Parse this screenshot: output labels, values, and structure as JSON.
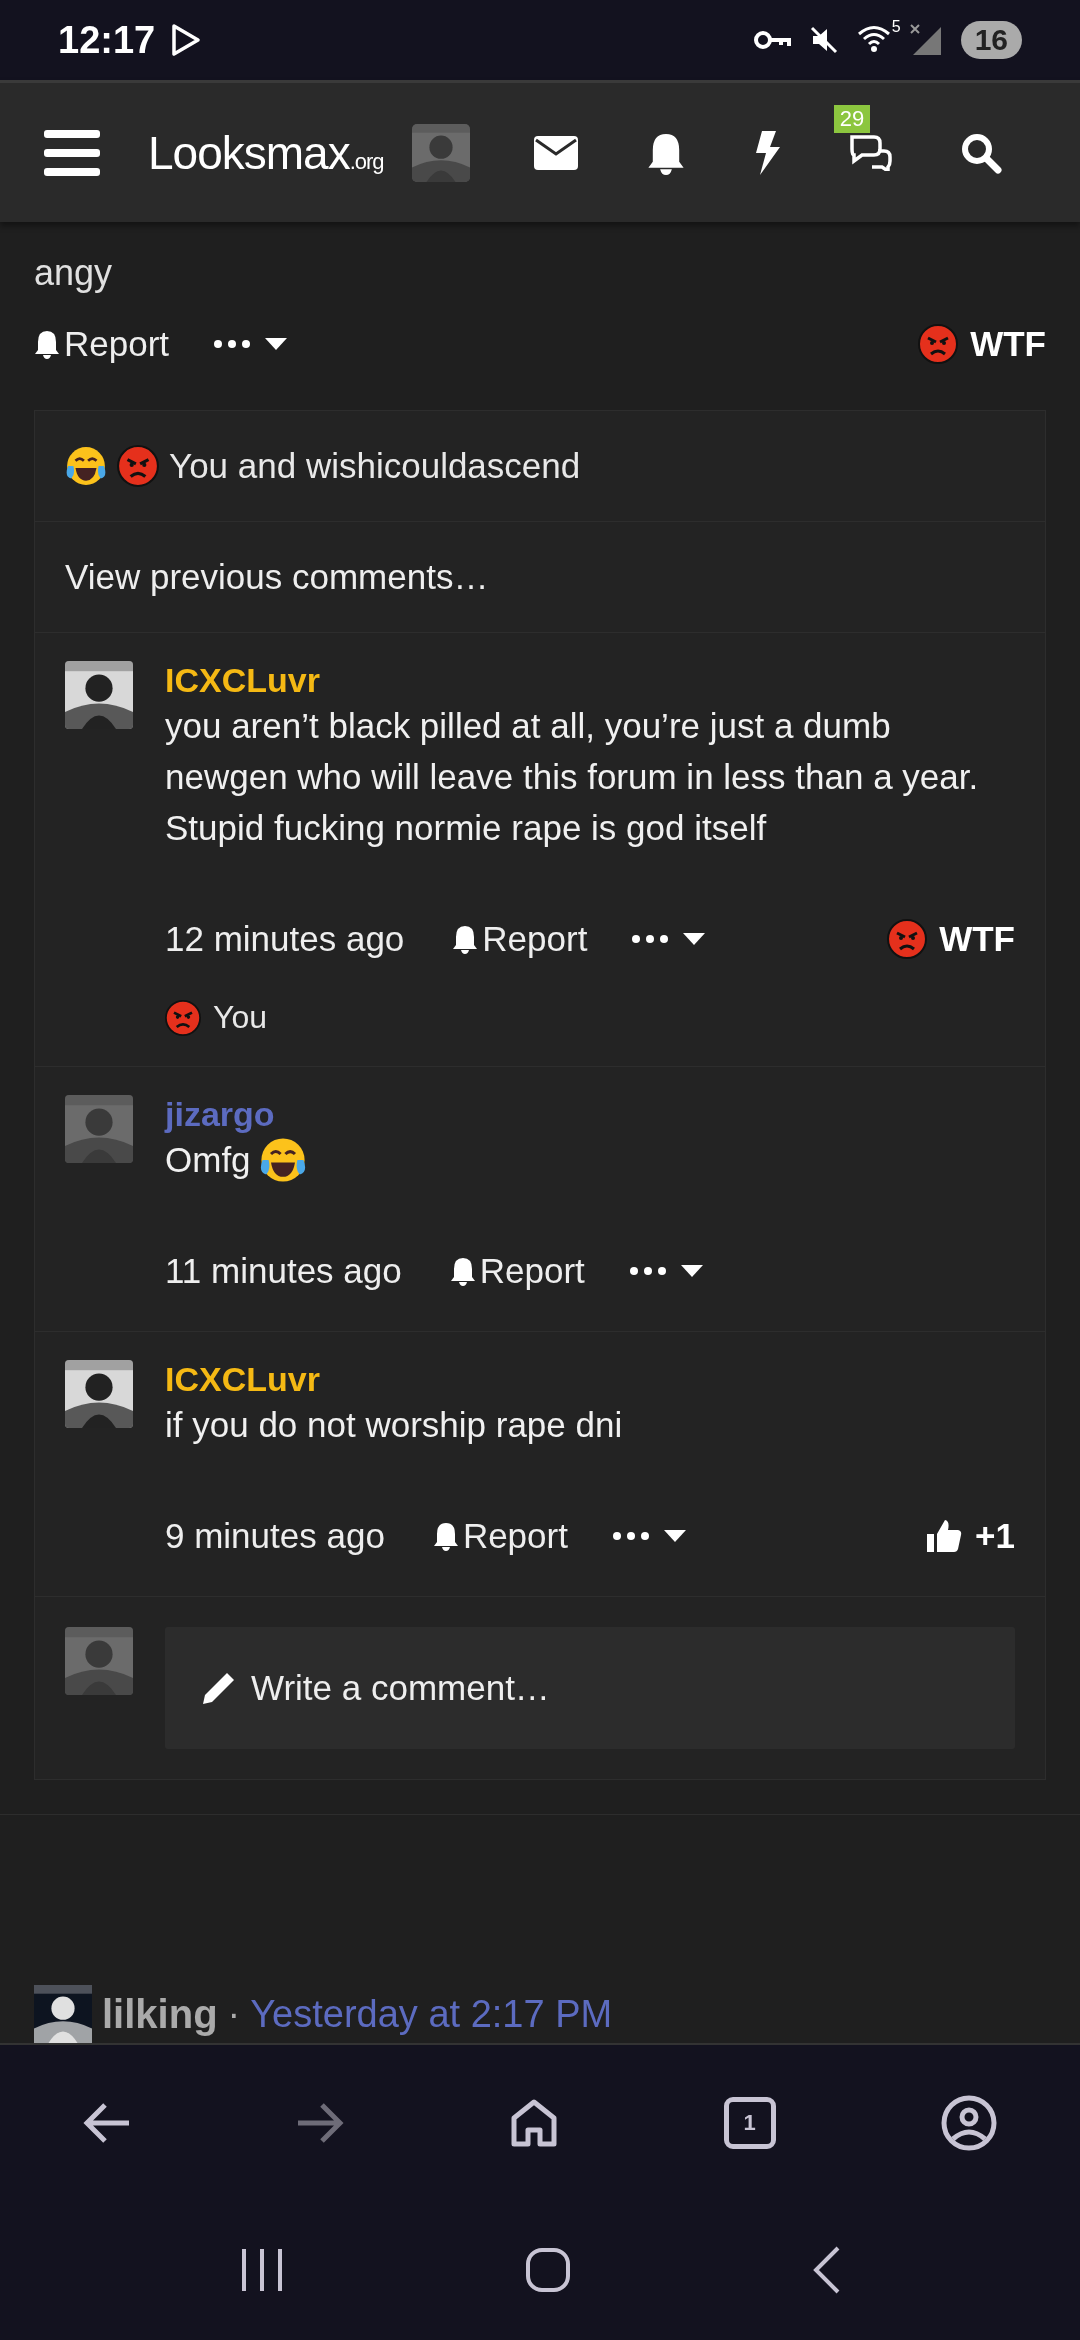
{
  "status_bar": {
    "time": "12:17",
    "wifi_badge": "5",
    "battery": "16"
  },
  "header": {
    "logo_main": "Looksmax",
    "logo_suffix": ".org",
    "chats_badge": "29"
  },
  "post": {
    "text_tail": "angy",
    "report": "Report",
    "reaction": {
      "kind": "angry",
      "label": "WTF"
    }
  },
  "comments_box": {
    "reaction_summary": {
      "emojis": [
        {
          "kind": "laugh"
        },
        {
          "kind": "angry"
        }
      ],
      "text": "You and wishicouldascend"
    },
    "view_previous": "View previous comments…",
    "comments": [
      {
        "author": "ICXCLuvr",
        "color": "#f5b914",
        "text": "you aren’t black pilled at all, you’re just a dumb newgen who will leave this forum in less than a year. Stupid fucking normie rape is god itself",
        "time": "12 minutes ago",
        "report": "Report",
        "reaction": {
          "kind": "angry",
          "label": "WTF"
        },
        "reacted_by": {
          "kind": "angry",
          "text": "You"
        }
      },
      {
        "author": "jizargo",
        "color": "#5c6bc0",
        "text": "Omfg",
        "inline_emoji": {
          "kind": "laugh"
        },
        "time": "11 minutes ago",
        "report": "Report"
      },
      {
        "author": "ICXCLuvr",
        "color": "#f5b914",
        "text": "if you do not worship rape dni",
        "time": "9 minutes ago",
        "report": "Report",
        "reaction": {
          "kind": "like",
          "label": "+1"
        }
      }
    ],
    "composer": {
      "placeholder": "Write a comment…"
    }
  },
  "next_post": {
    "author": "lilking",
    "separator": "·",
    "time": "Yesterday at 2:17 PM"
  },
  "browser_nav": {
    "tab_count": "1"
  }
}
